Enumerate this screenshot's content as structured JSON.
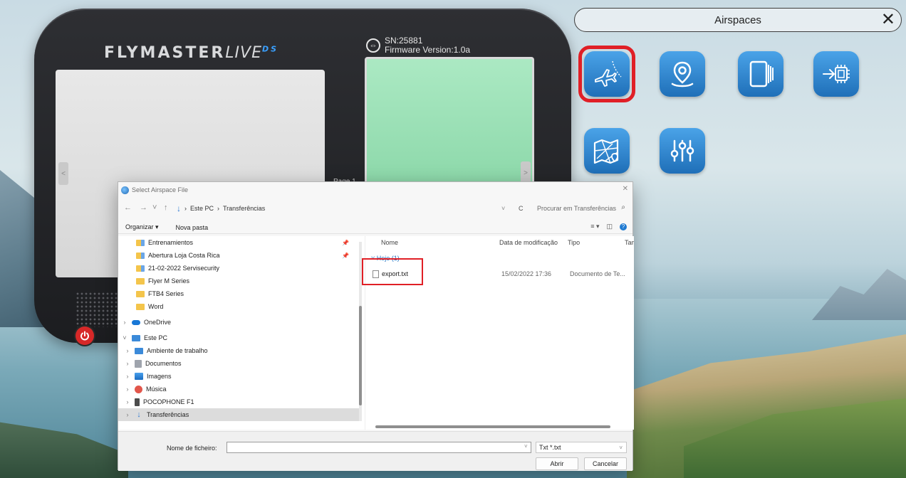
{
  "device": {
    "brand": "FLYMASTER",
    "brand_live": "LIVE",
    "brand_ds": "DS",
    "serial": "SN:25881",
    "firmware": "Firmware Version:1.0a",
    "page_label": "Page 1",
    "left_arrow": "<",
    "right_arrow": ">"
  },
  "airspaces": {
    "title": "Airspaces",
    "close": "✕",
    "tiles": [
      {
        "name": "airspaces-flight-icon",
        "selected": true
      },
      {
        "name": "location-pin-icon",
        "selected": false
      },
      {
        "name": "pages-icon",
        "selected": false
      },
      {
        "name": "firmware-chip-icon",
        "selected": false
      },
      {
        "name": "map-icon",
        "selected": false
      },
      {
        "name": "settings-sliders-icon",
        "selected": false
      }
    ],
    "highlight_color": "#e01f26"
  },
  "dialog": {
    "title": "Select Airspace File",
    "close": "✕",
    "nav_buttons": [
      "←",
      "→",
      "˅",
      "↑"
    ],
    "address": {
      "root": "Este PC",
      "sep": "›",
      "folder": "Transferências"
    },
    "refresh": "C",
    "search_placeholder": "Procurar em Transferências",
    "toolbar": {
      "organize": "Organizar ▾",
      "new_folder": "Nova pasta"
    },
    "nav_items": [
      {
        "label": "Entrenamientos",
        "icon": "shared-folder-icon",
        "pinned": true
      },
      {
        "label": "Abertura Loja Costa Rica",
        "icon": "shared-folder-icon",
        "pinned": true
      },
      {
        "label": "21-02-2022 Servisecurity",
        "icon": "shared-folder-icon",
        "pinned": false
      },
      {
        "label": "Flyer M Series",
        "icon": "folder-icon",
        "pinned": false
      },
      {
        "label": "FTB4 Series",
        "icon": "folder-icon",
        "pinned": false
      },
      {
        "label": "Word",
        "icon": "folder-icon",
        "pinned": false
      },
      {
        "label": "OneDrive",
        "icon": "cloud-icon",
        "pinned": false
      },
      {
        "label": "Este PC",
        "icon": "pc-icon",
        "pinned": false
      },
      {
        "label": "Ambiente de trabalho",
        "icon": "desktop-icon",
        "pinned": false
      },
      {
        "label": "Documentos",
        "icon": "documents-icon",
        "pinned": false
      },
      {
        "label": "Imagens",
        "icon": "images-icon",
        "pinned": false
      },
      {
        "label": "Música",
        "icon": "music-icon",
        "pinned": false
      },
      {
        "label": "POCOPHONE F1",
        "icon": "phone-icon",
        "pinned": false
      },
      {
        "label": "Transferências",
        "icon": "downloads-icon",
        "pinned": false
      }
    ],
    "columns": {
      "name": "Nome",
      "date": "Data de modificação",
      "type": "Tipo",
      "size": "Tam"
    },
    "group_label": "Hoje (1)",
    "files": [
      {
        "name": "export.txt",
        "date": "15/02/2022 17:36",
        "type": "Documento de Te..."
      }
    ],
    "filename_label": "Nome de ficheiro:",
    "filename_value": "",
    "filetype": "Txt *.txt",
    "open_button": "Abrir",
    "cancel_button": "Cancelar"
  }
}
